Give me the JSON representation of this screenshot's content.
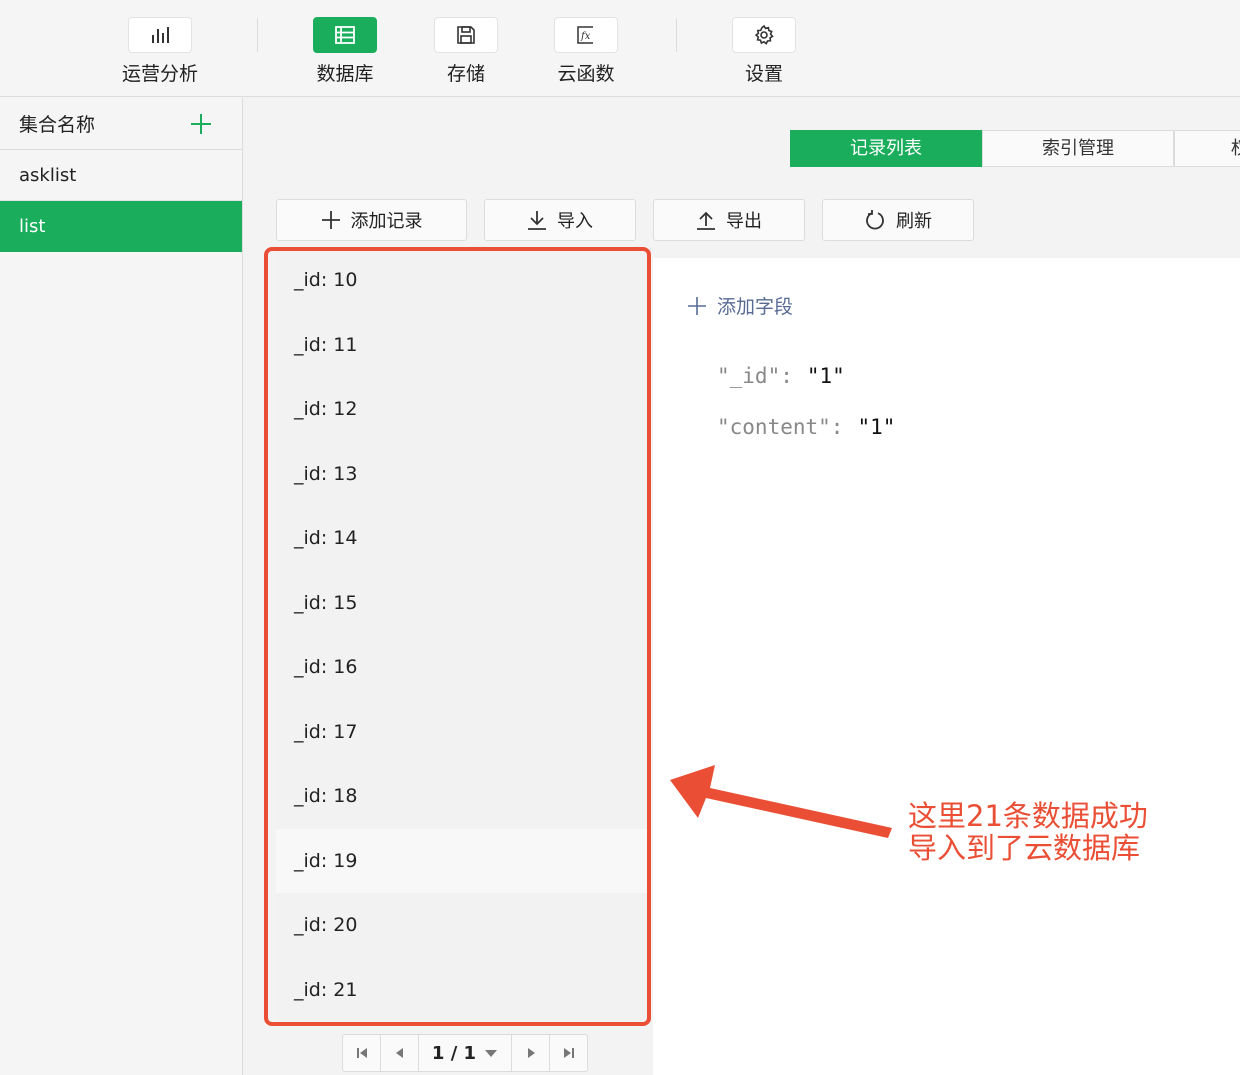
{
  "toolbar": {
    "items": [
      {
        "label": "运营分析",
        "icon": "bar-chart-icon"
      },
      {
        "label": "数据库",
        "icon": "database-icon",
        "active": true
      },
      {
        "label": "存储",
        "icon": "save-icon"
      },
      {
        "label": "云函数",
        "icon": "function-icon"
      },
      {
        "label": "设置",
        "icon": "gear-icon"
      }
    ]
  },
  "sidebar": {
    "header": "集合名称",
    "items": [
      {
        "label": "asklist"
      },
      {
        "label": "list",
        "selected": true
      }
    ]
  },
  "tabs": [
    {
      "label": "记录列表",
      "active": true
    },
    {
      "label": "索引管理"
    },
    {
      "label": "权"
    }
  ],
  "actions": {
    "add": "添加记录",
    "import": "导入",
    "export": "导出",
    "refresh": "刷新"
  },
  "records": [
    "_id: 10",
    "_id: 11",
    "_id: 12",
    "_id: 13",
    "_id: 14",
    "_id: 15",
    "_id: 16",
    "_id: 17",
    "_id: 18",
    "_id: 19",
    "_id: 20",
    "_id: 21"
  ],
  "detail": {
    "add_field": "添加字段",
    "fields": [
      {
        "key": "\"_id\":",
        "value": "\"1\""
      },
      {
        "key": "\"content\":",
        "value": "\"1\""
      }
    ]
  },
  "pager": {
    "page": "1 / 1"
  },
  "annotation": {
    "line1": "这里21条数据成功",
    "line2": "导入到了云数据库"
  },
  "colors": {
    "accent": "#1aad5b",
    "annotation": "#ea4f35",
    "link": "#576b95"
  }
}
